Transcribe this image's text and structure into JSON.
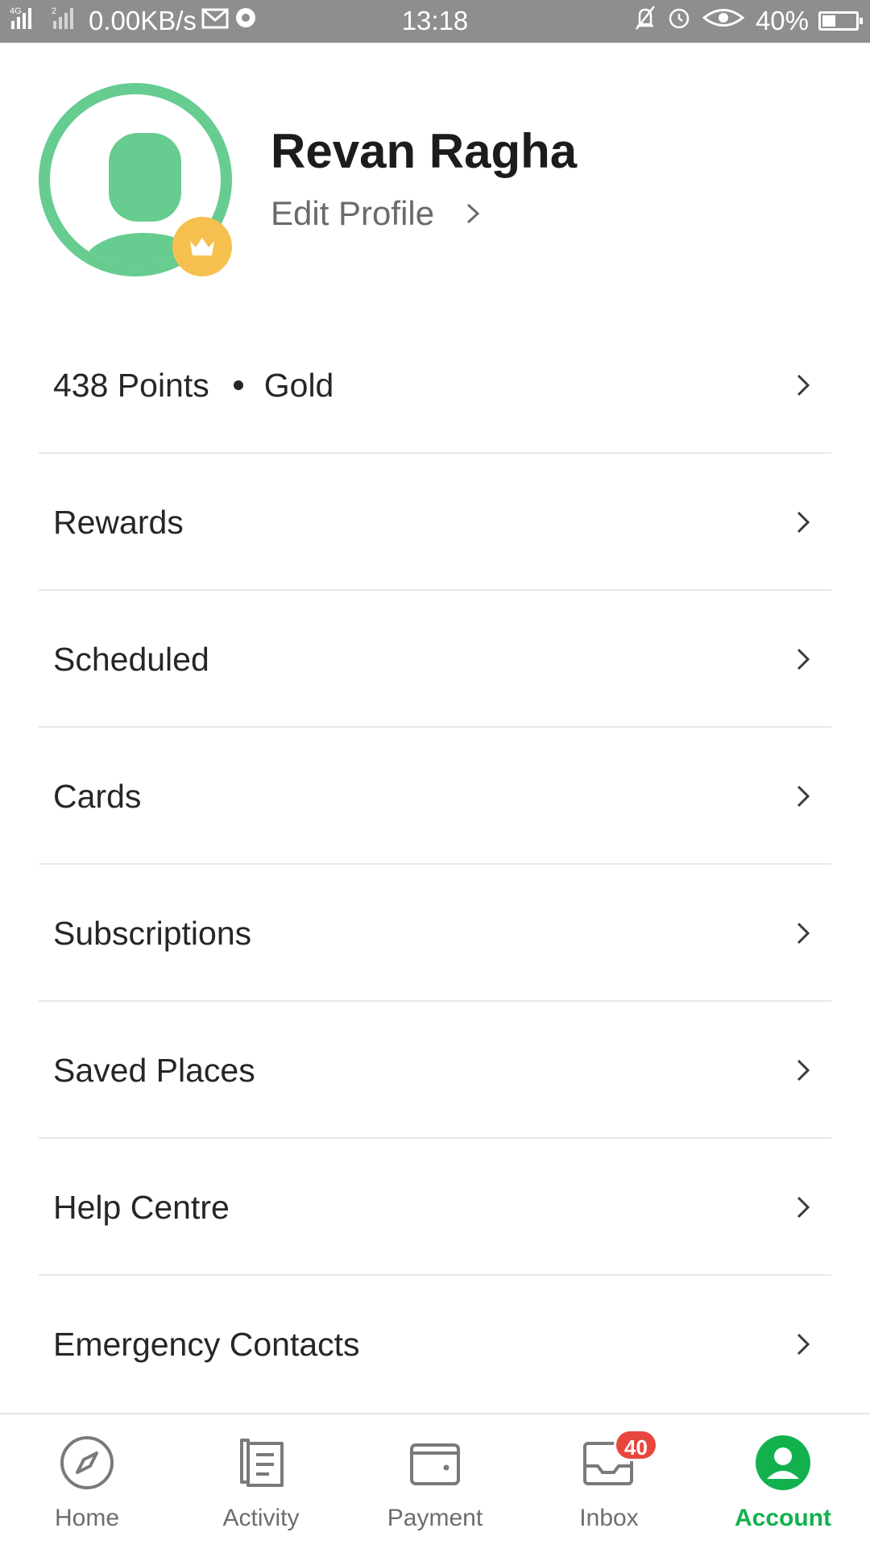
{
  "status_bar": {
    "network_left": "4G",
    "data_speed": "0.00KB/s",
    "time": "13:18",
    "battery": "40%",
    "battery_level": 0.4
  },
  "profile": {
    "name": "Revan Ragha",
    "edit_label": "Edit Profile"
  },
  "menu": {
    "points": "438 Points",
    "tier": "Gold",
    "items": [
      {
        "label": "Rewards"
      },
      {
        "label": "Scheduled"
      },
      {
        "label": "Cards"
      },
      {
        "label": "Subscriptions"
      },
      {
        "label": "Saved Places"
      },
      {
        "label": "Help Centre"
      },
      {
        "label": "Emergency Contacts"
      }
    ]
  },
  "bottom_nav": {
    "items": [
      {
        "label": "Home",
        "icon": "compass-icon"
      },
      {
        "label": "Activity",
        "icon": "receipt-icon"
      },
      {
        "label": "Payment",
        "icon": "wallet-icon"
      },
      {
        "label": "Inbox",
        "icon": "inbox-icon"
      },
      {
        "label": "Account",
        "icon": "account-icon"
      }
    ],
    "inbox_badge": "40",
    "active": "Account"
  },
  "colors": {
    "accent": "#12b14e",
    "avatar_green": "#66cc8f",
    "crown_badge": "#f5c04e",
    "badge_red": "#e8463c",
    "status_bar": "#8e8e8e"
  }
}
